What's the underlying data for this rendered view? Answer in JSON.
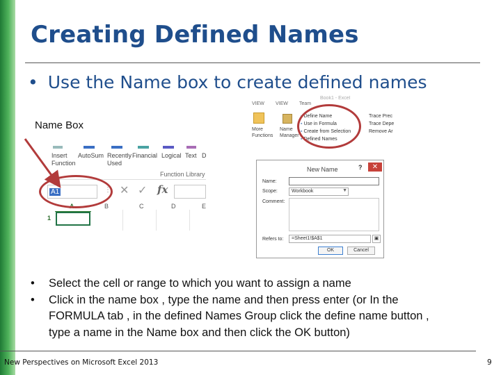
{
  "slide": {
    "title": "Creating Defined Names",
    "main_bullet": "Use the Name box to create defined names",
    "name_box_caption": "Name Box",
    "sub_bullets": [
      "Select the cell or range to which you want to assign a name",
      "Click in the name box , type the name and then press enter (or In the FORMULA tab , in the defined Names Group click the define name button , type a name in the Name box and then click the OK button)"
    ],
    "footer": "New Perspectives on Microsoft Excel 2013",
    "page_number": "9"
  },
  "ribbon_screenshot": {
    "window_title": "Book1 - Excel",
    "tabs": [
      "VIEW",
      "VIEW",
      "Team"
    ],
    "more_functions": "More\nFunctions",
    "name_manager": "Name\nManager",
    "defined_names": [
      "Define Name",
      "Use in Formula",
      "Create from Selection",
      "Defined Names"
    ],
    "trace": [
      "Trace Prec",
      "Trace Depe",
      "Remove Ar"
    ]
  },
  "excel_screenshot": {
    "ribbon_buttons": [
      "Insert\nFunction",
      "AutoSum",
      "Recently\nUsed",
      "Financial",
      "Logical",
      "Text",
      "D"
    ],
    "group_label": "Function Library",
    "name_box_value": "A1",
    "formula_fx": "fx",
    "columns": [
      "A",
      "B",
      "C",
      "D",
      "E"
    ],
    "row_numbers": [
      "1"
    ]
  },
  "new_name_dialog": {
    "title": "New Name",
    "help": "?",
    "close": "✕",
    "name_label": "Name:",
    "scope_label": "Scope:",
    "scope_value": "Workbook",
    "comment_label": "Comment:",
    "refers_to_label": "Refers to:",
    "refers_to_value": "=Sheet1!$A$1",
    "ok_label": "OK",
    "cancel_label": "Cancel"
  },
  "colors": {
    "title_blue": "#1f4e8c",
    "highlight_red": "#b23b3b",
    "excel_green": "#217346"
  }
}
